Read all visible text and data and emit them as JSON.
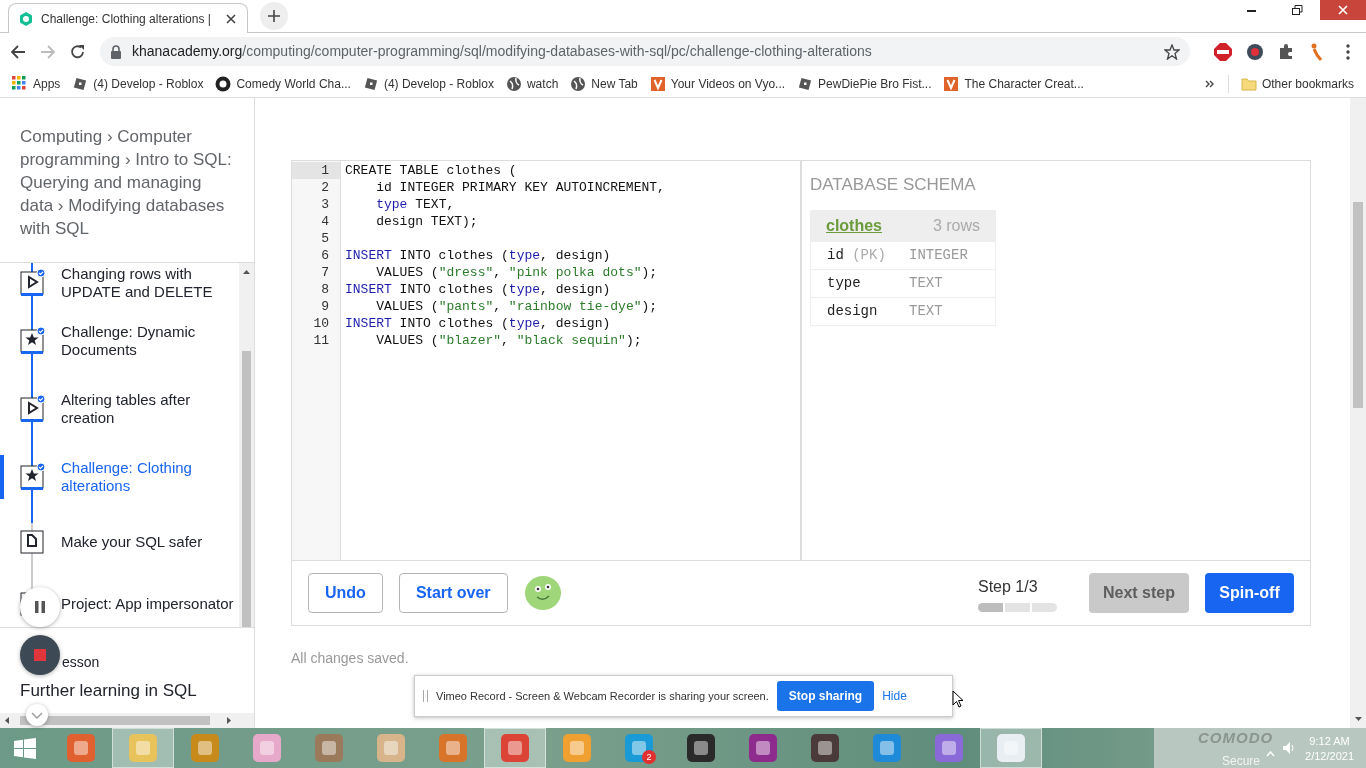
{
  "browser": {
    "tab": {
      "title": "Challenge: Clothing alterations |"
    },
    "url": {
      "host": "khanacademy.org",
      "path": "/computing/computer-programming/sql/modifying-databases-with-sql/pc/challenge-clothing-alterations"
    },
    "bookmarks": [
      {
        "label": "Apps",
        "kind": "grid"
      },
      {
        "label": "(4) Develop - Roblox",
        "kind": "square"
      },
      {
        "label": "Comedy World Cha...",
        "kind": "github"
      },
      {
        "label": "(4) Develop - Roblox",
        "kind": "square"
      },
      {
        "label": "watch",
        "kind": "globe"
      },
      {
        "label": "New Tab",
        "kind": "globe"
      },
      {
        "label": "Your Videos on Vyo...",
        "kind": "vtile"
      },
      {
        "label": "PewDiePie Bro Fist...",
        "kind": "square"
      },
      {
        "label": "The Character Creat...",
        "kind": "vtile"
      }
    ],
    "other_bookmarks": "Other bookmarks"
  },
  "sidebar": {
    "separator": "›",
    "breadcrumbs": [
      "Computing",
      "Computer programming",
      "Intro to SQL: Querying and managing data",
      "Modifying databases with SQL"
    ],
    "items": [
      {
        "label": "Changing rows with UPDATE and DELETE",
        "kind": "video",
        "done": true,
        "selected": false
      },
      {
        "label": "Challenge: Dynamic Documents",
        "kind": "challenge",
        "done": true,
        "selected": false
      },
      {
        "label": "Altering tables after creation",
        "kind": "video",
        "done": true,
        "selected": false
      },
      {
        "label": "Challenge: Clothing alterations",
        "kind": "challenge",
        "done": true,
        "selected": true
      },
      {
        "label": "Make your SQL safer",
        "kind": "article",
        "done": false,
        "selected": false
      },
      {
        "label": "Project: App impersonator",
        "kind": "project",
        "done": false,
        "selected": false
      }
    ],
    "next_lesson": {
      "caption": "esson",
      "title": "Further learning in SQL"
    }
  },
  "editor": {
    "lines": [
      {
        "number": "1",
        "active": true,
        "tokens": [
          {
            "text": "CREATE TABLE clothes (",
            "kind": "plain"
          }
        ]
      },
      {
        "number": "2",
        "active": false,
        "indented": true,
        "tokens": [
          {
            "text": "id INTEGER PRIMARY KEY AUTOINCREMENT,",
            "kind": "plain"
          }
        ]
      },
      {
        "number": "3",
        "active": false,
        "indented": true,
        "tokens": [
          {
            "text": "type",
            "kind": "keyword"
          },
          {
            "text": " TEXT,",
            "kind": "plain"
          }
        ]
      },
      {
        "number": "4",
        "active": false,
        "indented": true,
        "tokens": [
          {
            "text": "design TEXT);",
            "kind": "plain"
          }
        ]
      },
      {
        "number": "5",
        "active": false
      },
      {
        "number": "6",
        "active": false,
        "tokens": [
          {
            "text": "INSERT",
            "kind": "keyword"
          },
          {
            "text": " INTO clothes (",
            "kind": "plain"
          },
          {
            "text": "type",
            "kind": "keyword"
          },
          {
            "text": ", design)",
            "kind": "plain"
          }
        ]
      },
      {
        "number": "7",
        "active": false,
        "indented": true,
        "tokens": [
          {
            "text": "VALUES (",
            "kind": "plain"
          },
          {
            "text": "\"dress\"",
            "kind": "string"
          },
          {
            "text": ", ",
            "kind": "plain"
          },
          {
            "text": "\"pink polka dots\"",
            "kind": "string"
          },
          {
            "text": ");",
            "kind": "plain"
          }
        ]
      },
      {
        "number": "8",
        "active": false,
        "tokens": [
          {
            "text": "INSERT",
            "kind": "keyword"
          },
          {
            "text": " INTO clothes (",
            "kind": "plain"
          },
          {
            "text": "type",
            "kind": "keyword"
          },
          {
            "text": ", design)",
            "kind": "plain"
          }
        ]
      },
      {
        "number": "9",
        "active": false,
        "indented": true,
        "tokens": [
          {
            "text": "VALUES (",
            "kind": "plain"
          },
          {
            "text": "\"pants\"",
            "kind": "string"
          },
          {
            "text": ", ",
            "kind": "plain"
          },
          {
            "text": "\"rainbow tie-dye\"",
            "kind": "string"
          },
          {
            "text": ");",
            "kind": "plain"
          }
        ]
      },
      {
        "number": "10",
        "active": false,
        "tokens": [
          {
            "text": "INSERT",
            "kind": "keyword"
          },
          {
            "text": " INTO clothes (",
            "kind": "plain"
          },
          {
            "text": "type",
            "kind": "keyword"
          },
          {
            "text": ", design)",
            "kind": "plain"
          }
        ]
      },
      {
        "number": "11",
        "active": false,
        "indented": true,
        "tokens": [
          {
            "text": "VALUES (",
            "kind": "plain"
          },
          {
            "text": "\"blazer\"",
            "kind": "string"
          },
          {
            "text": ", ",
            "kind": "plain"
          },
          {
            "text": "\"black sequin\"",
            "kind": "string"
          },
          {
            "text": ");",
            "kind": "plain"
          }
        ]
      }
    ],
    "schema": {
      "title": "DATABASE SCHEMA",
      "table": "clothes",
      "count": "3 rows",
      "columns": [
        {
          "name": "id",
          "note": "(PK)",
          "type": "INTEGER"
        },
        {
          "name": "type",
          "type": "TEXT"
        },
        {
          "name": "design",
          "type": "TEXT"
        }
      ]
    },
    "footer": {
      "undo": "Undo",
      "start_over": "Start over",
      "step": "Step 1/3",
      "step_segments": [
        {
          "done": true
        },
        {
          "done": false
        },
        {
          "done": false
        }
      ],
      "next_step": {
        "label": "Next step",
        "disabled": true
      },
      "spin_off": "Spin-off"
    },
    "status": "All changes saved."
  },
  "share_bar": {
    "message": "Vimeo Record - Screen & Webcam Recorder is sharing your screen.",
    "stop": "Stop sharing",
    "hide": "Hide"
  },
  "taskbar": {
    "apps": [
      {
        "color": "#e0612f",
        "active": false
      },
      {
        "color": "#e8c25a",
        "active": true
      },
      {
        "color": "#c98a1c",
        "active": false
      },
      {
        "color": "#e7a9c9",
        "active": false
      },
      {
        "color": "#9a7a5a",
        "active": false
      },
      {
        "color": "#d7b48a",
        "active": false
      },
      {
        "color": "#d8742a",
        "active": false
      },
      {
        "color": "#db4437",
        "active": true
      },
      {
        "color": "#f0a030",
        "active": false
      },
      {
        "color": "#1a9ad6",
        "active": false,
        "badge": "2"
      },
      {
        "color": "#2a2a2a",
        "active": false
      },
      {
        "color": "#8e2c8e",
        "active": false
      },
      {
        "color": "#4a3a3a",
        "active": false
      },
      {
        "color": "#1f8ad8",
        "active": false
      },
      {
        "color": "#8a6ad8",
        "active": false
      },
      {
        "color": "#e8eef2",
        "active": true
      }
    ],
    "tray": {
      "brand": "COMODO",
      "status": "Secure",
      "time": "9:12 AM",
      "date": "2/12/2021"
    }
  }
}
